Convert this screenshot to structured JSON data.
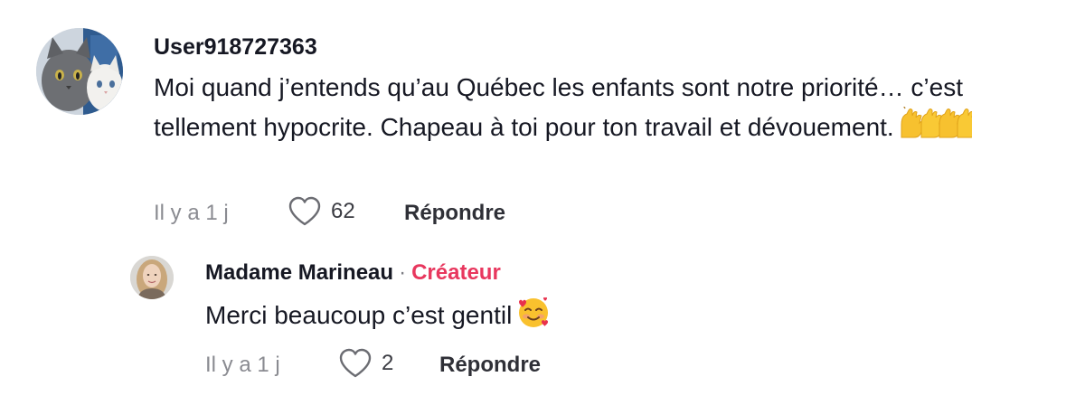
{
  "main_comment": {
    "username": "User918727363",
    "text": "Moi quand j’entends qu’au Québec les enfants sont notre priorité… c’est tellement hypocrite. Chapeau à toi pour ton travail et dévouement.",
    "emojis": "🙌🙌",
    "time": "Il y a 1 j",
    "likes": "62",
    "reply_label": "Répondre",
    "avatar": "cats-avatar"
  },
  "reply_comment": {
    "username": "Madame Marineau",
    "separator": "·",
    "creator_badge": "Créateur",
    "text": "Merci beaucoup c’est gentil",
    "emoji": "🥰",
    "time": "Il y a 1 j",
    "likes": "2",
    "reply_label": "Répondre",
    "avatar": "woman-avatar"
  },
  "colors": {
    "text": "#161823",
    "muted": "#8a8b91",
    "creator": "#e8375e"
  }
}
